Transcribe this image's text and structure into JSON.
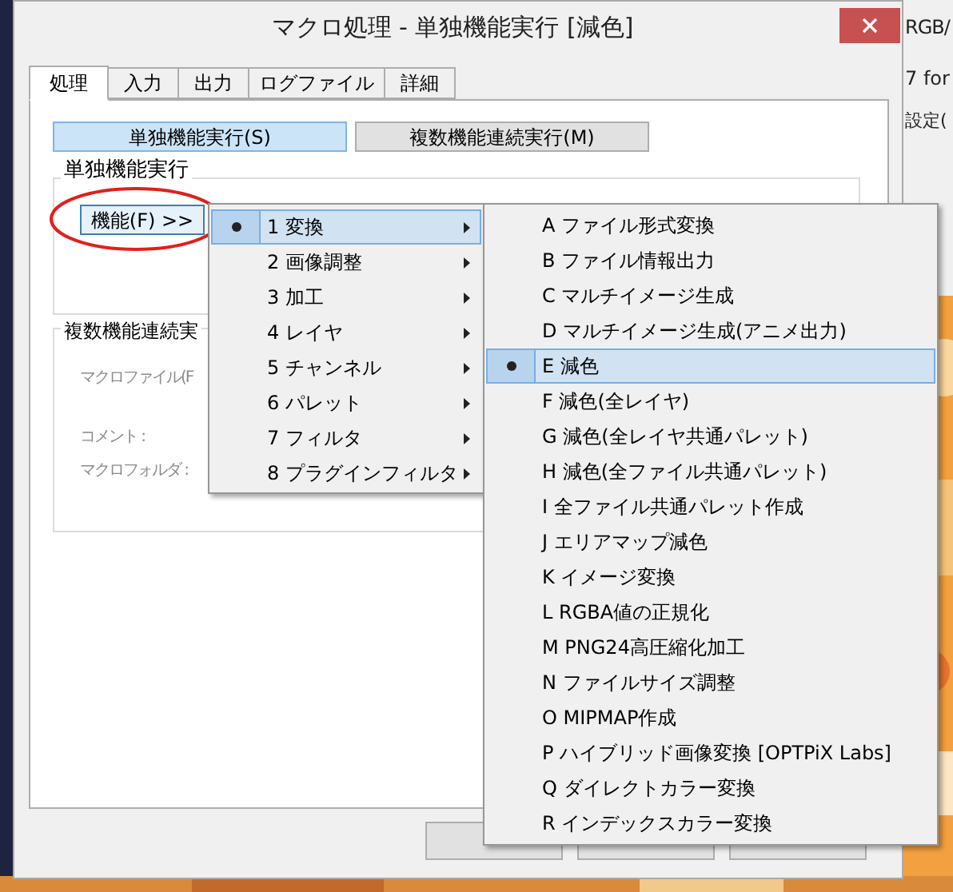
{
  "background_app": {
    "texts": [
      "RGB/",
      "7 for",
      "設定("
    ]
  },
  "window": {
    "title": "マクロ処理 - 単独機能実行 [減色]"
  },
  "tabs": [
    {
      "label": "処理",
      "selected": true
    },
    {
      "label": "入力",
      "selected": false
    },
    {
      "label": "出力",
      "selected": false
    },
    {
      "label": "ログファイル",
      "selected": false
    },
    {
      "label": "詳細",
      "selected": false
    }
  ],
  "mode_buttons": [
    {
      "label": "単独機能実行(S)",
      "selected": true
    },
    {
      "label": "複数機能連続実行(M)",
      "selected": false
    }
  ],
  "single_group": {
    "title": "単独機能実行",
    "function_button": "機能(F) >>"
  },
  "multi_group": {
    "title": "複数機能連続実",
    "labels": [
      "マクロファイル(F",
      "コメント :",
      "マクロフォルダ :"
    ],
    "disabled": true
  },
  "menu": [
    {
      "label": "1 変換",
      "selected": true,
      "submenu": true
    },
    {
      "label": "2 画像調整",
      "selected": false,
      "submenu": true
    },
    {
      "label": "3 加工",
      "selected": false,
      "submenu": true
    },
    {
      "label": "4 レイヤ",
      "selected": false,
      "submenu": true
    },
    {
      "label": "5 チャンネル",
      "selected": false,
      "submenu": true
    },
    {
      "label": "6 パレット",
      "selected": false,
      "submenu": true
    },
    {
      "label": "7 フィルタ",
      "selected": false,
      "submenu": true
    },
    {
      "label": "8 プラグインフィルタ",
      "selected": false,
      "submenu": true
    }
  ],
  "submenu": [
    {
      "label": "A ファイル形式変換",
      "selected": false
    },
    {
      "label": "B ファイル情報出力",
      "selected": false
    },
    {
      "label": "C マルチイメージ生成",
      "selected": false
    },
    {
      "label": "D マルチイメージ生成(アニメ出力)",
      "selected": false
    },
    {
      "label": "E 減色",
      "selected": true
    },
    {
      "label": "F 減色(全レイヤ)",
      "selected": false
    },
    {
      "label": "G 減色(全レイヤ共通パレット)",
      "selected": false
    },
    {
      "label": "H 減色(全ファイル共通パレット)",
      "selected": false
    },
    {
      "label": "I 全ファイル共通パレット作成",
      "selected": false
    },
    {
      "label": "J エリアマップ減色",
      "selected": false
    },
    {
      "label": "K イメージ変換",
      "selected": false
    },
    {
      "label": "L RGBA値の正規化",
      "selected": false
    },
    {
      "label": "M PNG24高圧縮化加工",
      "selected": false
    },
    {
      "label": "N ファイルサイズ調整",
      "selected": false
    },
    {
      "label": "O MIPMAP作成",
      "selected": false
    },
    {
      "label": "P ハイブリッド画像変換 [OPTPiX Labs]",
      "selected": false
    },
    {
      "label": "Q ダイレクトカラー変換",
      "selected": false
    },
    {
      "label": "R インデックスカラー変換",
      "selected": false
    }
  ]
}
